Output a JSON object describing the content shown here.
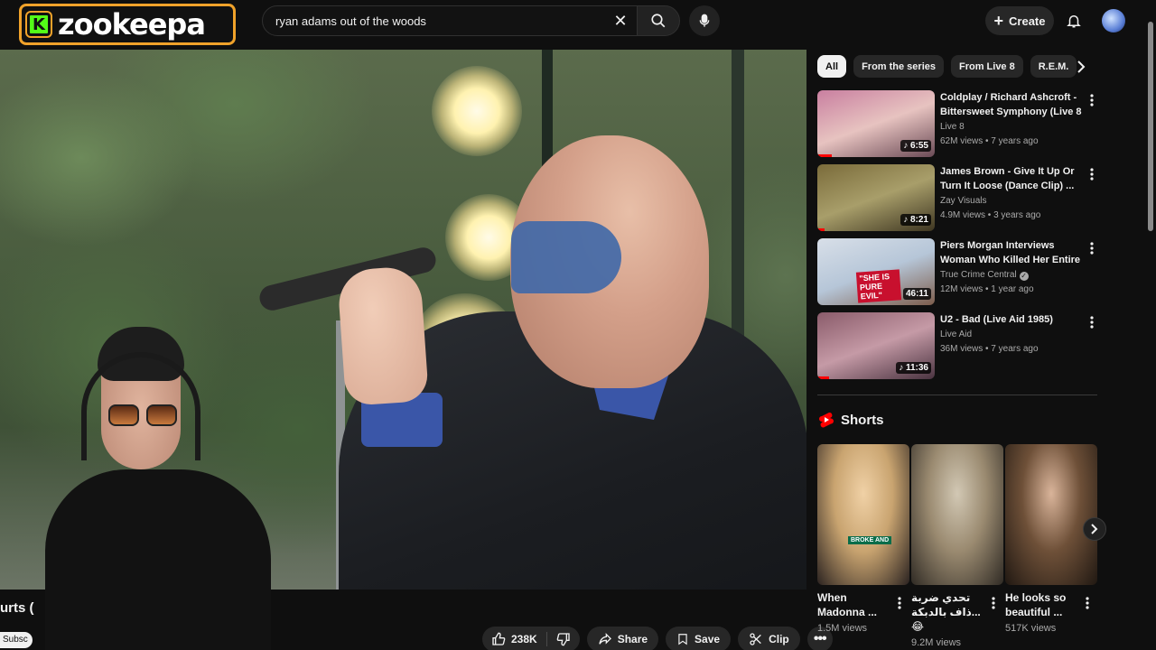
{
  "logo": {
    "badge": "K",
    "text": "zookeepa"
  },
  "search": {
    "value": "ryan adams out of the woods",
    "placeholder": "Search"
  },
  "header": {
    "create_label": "Create"
  },
  "video": {
    "title_fragment": "urts (",
    "subscribe_fragment": "Subsc"
  },
  "actions": {
    "likes": "238K",
    "share": "Share",
    "save": "Save",
    "clip": "Clip"
  },
  "chips": [
    {
      "label": "All",
      "active": true
    },
    {
      "label": "From the series"
    },
    {
      "label": "From Live 8"
    },
    {
      "label": "R.E.M."
    }
  ],
  "recommendations": [
    {
      "title": "Coldplay / Richard Ashcroft - Bittersweet Symphony (Live 8 ...",
      "channel": "Live 8",
      "meta": "62M views • 7 years ago",
      "duration": "♪ 6:55",
      "progress": 0.12,
      "thumb_colors": [
        "#c97fa0",
        "#e7c3c0",
        "#6a4a55"
      ]
    },
    {
      "title": "James Brown - Give It Up Or Turn It Loose (Dance Clip) ...",
      "channel": "Zay Visuals",
      "meta": "4.9M views • 3 years ago",
      "duration": "♪ 8:21",
      "progress": 0.06,
      "thumb_colors": [
        "#7a6b3a",
        "#a89e6a",
        "#3e3621"
      ]
    },
    {
      "title": "Piers Morgan Interviews Woman Who Killed Her Entire ...",
      "channel": "True Crime Central",
      "meta": "12M views • 1 year ago",
      "duration": "46:11",
      "verified": true,
      "progress": 0,
      "overlay_text": "\"SHE IS PURE EVIL\"",
      "thumb_colors": [
        "#d8dfe8",
        "#b6c6d8",
        "#7d5d4c"
      ]
    },
    {
      "title": "U2 - Bad (Live Aid 1985)",
      "channel": "Live Aid",
      "meta": "36M views • 7 years ago",
      "duration": "♪ 11:36",
      "progress": 0.1,
      "thumb_colors": [
        "#8a5b6a",
        "#c59aa6",
        "#4a3340"
      ]
    }
  ],
  "shorts": {
    "heading": "Shorts",
    "items": [
      {
        "title": "When Madonna ...",
        "views": "1.5M views",
        "overlay": "BROKE AND",
        "thumb_colors": [
          "#c9a470",
          "#f0d1a6",
          "#2a2220"
        ]
      },
      {
        "title": "تحدي ضربة ...ذاف بالدبكة 😂",
        "views": "9.2M views",
        "thumb_colors": [
          "#9a8a70",
          "#d2c8b4",
          "#2f2a24"
        ]
      },
      {
        "title": "He looks so beautiful ...",
        "views": "517K views",
        "thumb_colors": [
          "#6e5038",
          "#d9b49a",
          "#201812"
        ]
      }
    ]
  },
  "icons": {
    "accent_red": "#ff0000",
    "chip_active_bg": "#f1f1f1"
  }
}
